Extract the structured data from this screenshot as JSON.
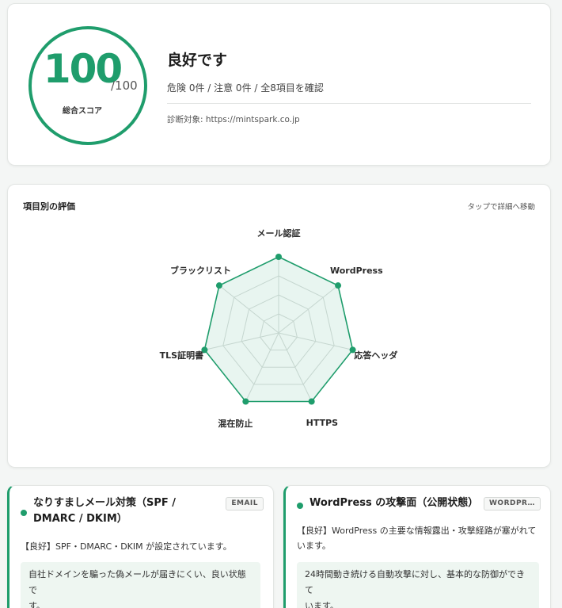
{
  "score": {
    "value": "100",
    "max": "/100",
    "caption": "総合スコア",
    "verdict": "良好です",
    "summary": "危険 0件 / 注意 0件 / 全8項目を確認",
    "target": "診断対象: https://mintspark.co.jp"
  },
  "radar": {
    "title": "項目別の評価",
    "hint": "タップで詳細へ移動",
    "axes": [
      "メール認証",
      "WordPress",
      "応答ヘッダ",
      "HTTPS",
      "混在防止",
      "TLS証明書",
      "ブラックリスト"
    ],
    "values": [
      100,
      100,
      100,
      100,
      100,
      100,
      100
    ],
    "max": 100,
    "accent": "#1f9d6c"
  },
  "cards": [
    {
      "title": "なりすましメール対策（SPF / DMARC / DKIM）",
      "title_line1": "なりすましメール対策（SPF /",
      "title_line2": "DMARC / DKIM）",
      "tag": "EMAIL",
      "result_line1": "【良好】SPF・DMARC・DKIM が設定されています。",
      "box_line1": "自社ドメインを騙った偽メールが届きにくい、良い状態で",
      "box_line2": "す。"
    },
    {
      "title": "WordPress の攻撃面（公開状態）",
      "tag": "WORDPR…",
      "result_line1": "【良好】WordPress の主要な情報露出・攻撃経路が塞がれて",
      "result_line2": "います。",
      "box_line1": "24時間動き続ける自動攻撃に対し、基本的な防御ができて",
      "box_line2": "います。"
    }
  ]
}
